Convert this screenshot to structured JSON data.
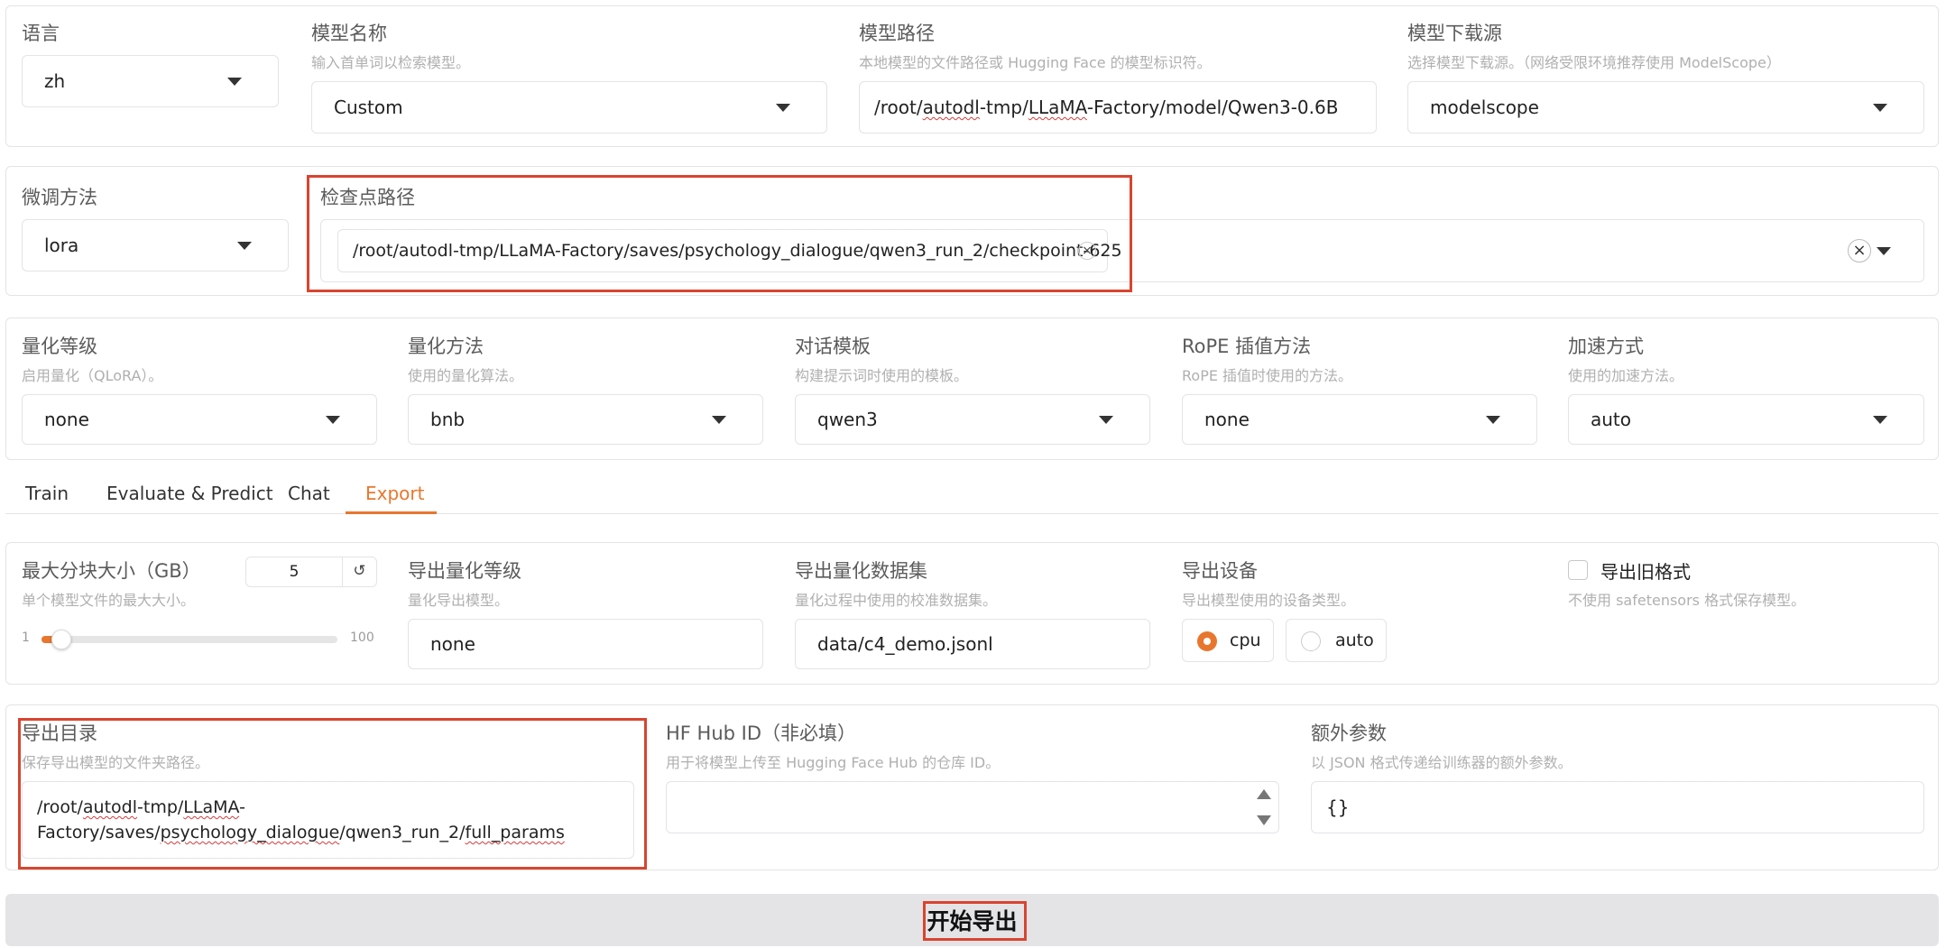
{
  "model": {
    "language": {
      "label": "语言",
      "value": "zh"
    },
    "model_name": {
      "label": "模型名称",
      "hint": "输入首单词以检索模型。",
      "value": "Custom"
    },
    "model_path": {
      "label": "模型路径",
      "hint": "本地模型的文件路径或 Hugging Face 的模型标识符。",
      "value_pre": "/root/",
      "value_sq1": "autodl",
      "value_mid": "-tmp/",
      "value_sq2": "LLaMA",
      "value_post": "-Factory/model/Qwen3-0.6B"
    },
    "download_source": {
      "label": "模型下载源",
      "hint": "选择模型下载源。（网络受限环境推荐使用 ModelScope）",
      "value": "modelscope"
    }
  },
  "finetune": {
    "method": {
      "label": "微调方法",
      "value": "lora"
    },
    "checkpoint": {
      "label": "检查点路径",
      "tag": "/root/autodl-tmp/LLaMA-Factory/saves/psychology_dialogue/qwen3_run_2/checkpoint-625",
      "tag_remove": "×",
      "clear": "×"
    }
  },
  "advanced": {
    "quant_bit": {
      "label": "量化等级",
      "hint": "启用量化（QLoRA）。",
      "value": "none"
    },
    "quant_method": {
      "label": "量化方法",
      "hint": "使用的量化算法。",
      "value": "bnb"
    },
    "template": {
      "label": "对话模板",
      "hint": "构建提示词时使用的模板。",
      "value": "qwen3"
    },
    "rope": {
      "label": "RoPE 插值方法",
      "hint": "RoPE 插值时使用的方法。",
      "value": "none"
    },
    "booster": {
      "label": "加速方式",
      "hint": "使用的加速方法。",
      "value": "auto"
    }
  },
  "tabs": [
    {
      "label": "Train"
    },
    {
      "label": "Evaluate & Predict"
    },
    {
      "label": "Chat"
    },
    {
      "label": "Export",
      "active": true
    }
  ],
  "export": {
    "shard_size": {
      "label": "最大分块大小（GB）",
      "hint": "单个模型文件的最大大小。",
      "value": "5",
      "min": "1",
      "max": "100",
      "current": 5,
      "reset": "↺"
    },
    "quant_bit": {
      "label": "导出量化等级",
      "hint": "量化导出模型。",
      "value": "none"
    },
    "quant_dataset": {
      "label": "导出量化数据集",
      "hint": "量化过程中使用的校准数据集。",
      "value": "data/c4_demo.jsonl"
    },
    "device": {
      "label": "导出设备",
      "hint": "导出模型使用的设备类型。",
      "options": [
        "cpu",
        "auto"
      ],
      "selected": "cpu"
    },
    "legacy": {
      "label": "导出旧格式",
      "hint": "不使用 safetensors 格式保存模型。",
      "checked": false
    },
    "dir": {
      "label": "导出目录",
      "hint": "保存导出模型的文件夹路径。"
    },
    "hub_id": {
      "label": "HF Hub ID（非必填）",
      "hint": "用于将模型上传至 Hugging Face Hub 的仓库 ID。",
      "value": ""
    },
    "extra": {
      "label": "额外参数",
      "hint": "以 JSON 格式传递给训练器的额外参数。",
      "value": "{}"
    },
    "button": "开始导出"
  },
  "colors": {
    "accent": "#e8772e",
    "highlight": "#d9442f",
    "border": "#e4e4e7"
  }
}
